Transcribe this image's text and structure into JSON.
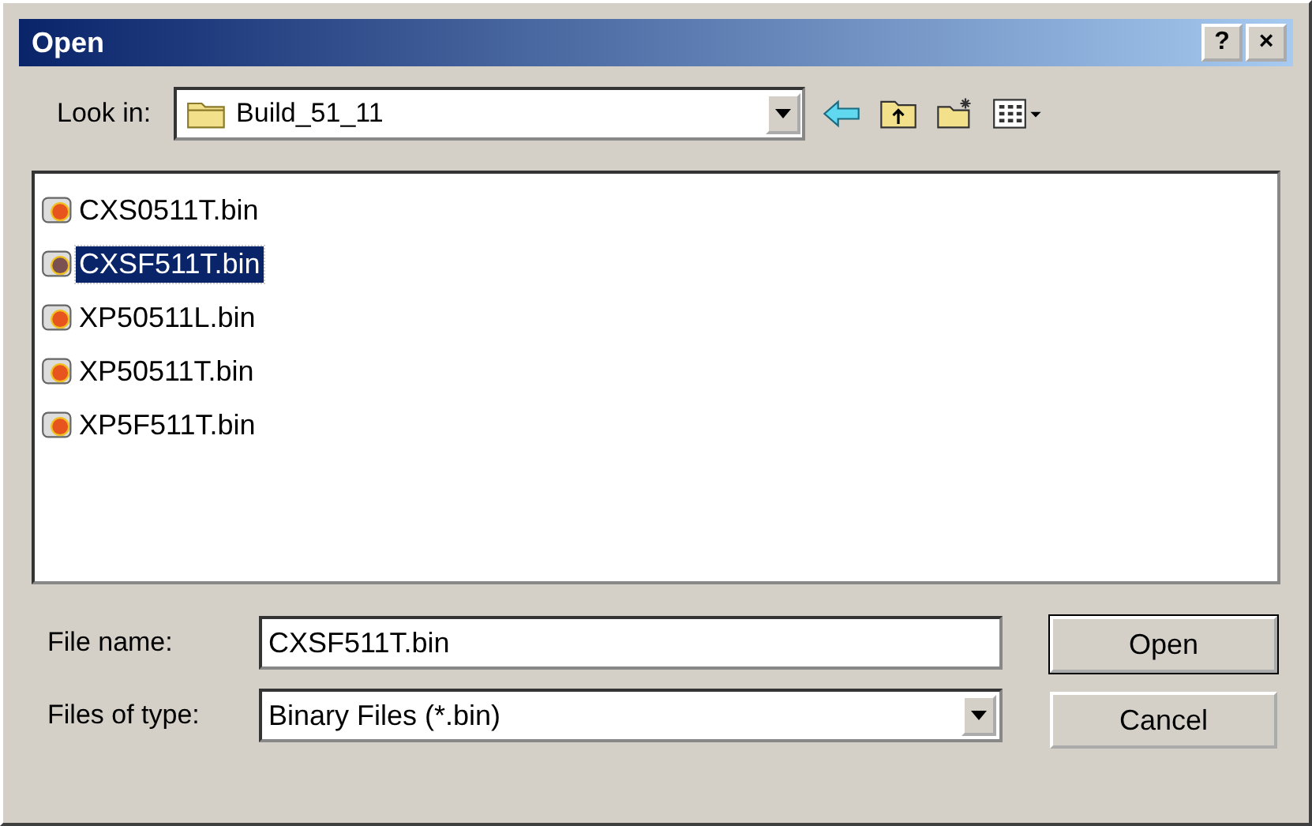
{
  "window": {
    "title": "Open",
    "help_button": "?",
    "close_button": "×"
  },
  "look_in": {
    "label": "Look in:",
    "value": "Build_51_11"
  },
  "files": [
    {
      "name": "CXS0511T.bin",
      "selected": false
    },
    {
      "name": "CXSF511T.bin",
      "selected": true
    },
    {
      "name": "XP50511L.bin",
      "selected": false
    },
    {
      "name": "XP50511T.bin",
      "selected": false
    },
    {
      "name": "XP5F511T.bin",
      "selected": false
    }
  ],
  "file_name": {
    "label": "File name:",
    "value": "CXSF511T.bin"
  },
  "file_type": {
    "label": "Files of type:",
    "value": "Binary Files (*.bin)"
  },
  "buttons": [
    {
      "label": "Open",
      "default": true
    },
    {
      "label": "Cancel",
      "default": false
    }
  ]
}
